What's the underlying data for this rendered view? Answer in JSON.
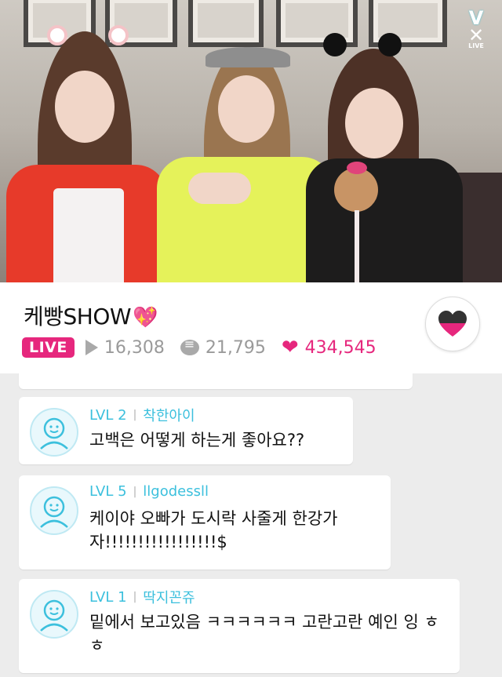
{
  "video": {
    "logo": {
      "v": "V",
      "x": "✕",
      "live": "LIVE"
    }
  },
  "info": {
    "title": "케빵SHOW",
    "title_emoji": "💖",
    "live_badge": "LIVE",
    "views": "16,308",
    "comments": "21,795",
    "likes": "434,545"
  },
  "colors": {
    "accent": "#e6277d",
    "level_text": "#3cc0dd"
  },
  "chat": {
    "messages": [
      {
        "level": "LVL 2",
        "user": "착한아이",
        "text": "고백은 어떻게 하는게 좋아요??"
      },
      {
        "level": "LVL 5",
        "user": "llgodessll",
        "text": "케이야 오빠가 도시락 사줄게 한강가 자!!!!!!!!!!!!!!!!!$"
      },
      {
        "level": "LVL 1",
        "user": "딱지꼰쥬",
        "text": "밑에서 보고있음 ㅋㅋㅋㅋㅋㅋ 고란고란 예인 잉 ㅎㅎ"
      }
    ]
  }
}
